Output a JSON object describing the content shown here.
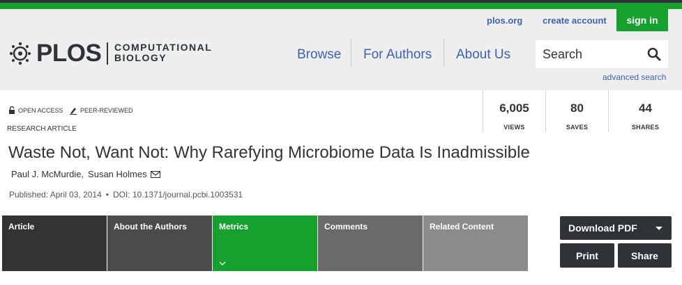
{
  "utility": {
    "plos_org": "plos.org",
    "create_account": "create account",
    "sign_in": "sign in"
  },
  "logo": {
    "word": "PLOS",
    "journal_line1": "COMPUTATIONAL",
    "journal_line2": "BIOLOGY"
  },
  "nav": {
    "items": [
      {
        "label": "Browse"
      },
      {
        "label": "For Authors"
      },
      {
        "label": "About Us"
      }
    ]
  },
  "search": {
    "placeholder": "Search",
    "advanced": "advanced search",
    "icon": "magnifier-icon"
  },
  "article": {
    "badges": {
      "open_access": "OPEN ACCESS",
      "peer_reviewed": "PEER-REVIEWED"
    },
    "type": "RESEARCH ARTICLE",
    "title": "Waste Not, Want Not: Why Rarefying Microbiome Data Is Inadmissible",
    "authors": [
      "Paul J. McMurdie,",
      "Susan Holmes"
    ],
    "published": "Published: April 03, 2014",
    "doi": "DOI: 10.1371/journal.pcbi.1003531"
  },
  "metrics": [
    {
      "value": "6,005",
      "label": "VIEWS"
    },
    {
      "value": "80",
      "label": "SAVES"
    },
    {
      "value": "44",
      "label": "SHARES"
    }
  ],
  "tabs": [
    {
      "label": "Article"
    },
    {
      "label": "About the Authors"
    },
    {
      "label": "Metrics"
    },
    {
      "label": "Comments"
    },
    {
      "label": "Related Content"
    }
  ],
  "actions": {
    "download_pdf": "Download PDF",
    "print": "Print",
    "share": "Share"
  },
  "colors": {
    "brand_green": "#16a12e",
    "link_blue": "#3c63af",
    "dark": "#2f3338"
  }
}
